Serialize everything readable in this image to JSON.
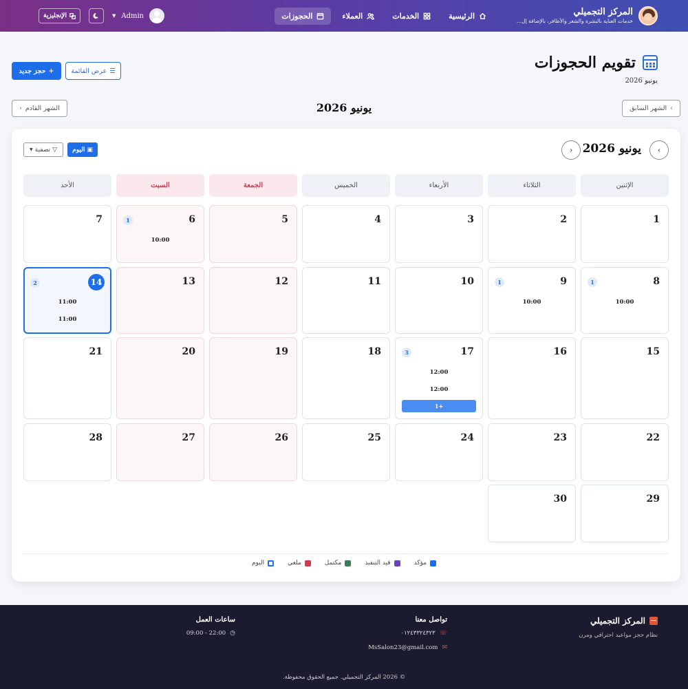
{
  "nav": {
    "brand_name": "المركز التجميلي",
    "brand_tagline": "خدمات العناية بالبشرة والشعر والأظافر، بالإضافة إل...",
    "links": [
      {
        "label": "الرئيسية",
        "icon": "home-icon"
      },
      {
        "label": "الخدمات",
        "icon": "grid-icon"
      },
      {
        "label": "العملاء",
        "icon": "users-icon"
      },
      {
        "label": "الحجوزات",
        "icon": "calendar-icon",
        "active": true
      }
    ],
    "admin_name": "Admin",
    "lang_label": "الإنجليزية"
  },
  "header": {
    "title": "تقويم الحجوزات",
    "subtitle": "يونيو 2026",
    "new_booking": "حجز جديد",
    "list_view": "عرض القائمة",
    "prev_month": "الشهر السابق",
    "next_month": "الشهر القادم",
    "month_label": "يونيو 2026"
  },
  "calendar": {
    "title": "يونيو 2026",
    "today_label": "اليوم",
    "filter_label": "تصفية",
    "weekdays": [
      "الإثنين",
      "الثلاثاء",
      "الأربعاء",
      "الخميس",
      "الجمعة",
      "السبت",
      "الأحد"
    ],
    "weeks": [
      [
        {
          "day": "1"
        },
        {
          "day": "2"
        },
        {
          "day": "3"
        },
        {
          "day": "4"
        },
        {
          "day": "5"
        },
        {
          "day": "6",
          "count": "1",
          "events": [
            "10:00"
          ]
        },
        {
          "day": "7"
        }
      ],
      [
        {
          "day": "8",
          "count": "1",
          "events": [
            "10:00"
          ]
        },
        {
          "day": "9",
          "count": "1",
          "events": [
            "10:00"
          ]
        },
        {
          "day": "10"
        },
        {
          "day": "11"
        },
        {
          "day": "12"
        },
        {
          "day": "13"
        },
        {
          "day": "14",
          "count": "2",
          "events": [
            "11:00",
            "11:00"
          ],
          "today": true
        }
      ],
      [
        {
          "day": "15"
        },
        {
          "day": "16"
        },
        {
          "day": "17",
          "count": "3",
          "events": [
            "12:00",
            "12:00"
          ],
          "more": "+1"
        },
        {
          "day": "18"
        },
        {
          "day": "19"
        },
        {
          "day": "20"
        },
        {
          "day": "21"
        }
      ],
      [
        {
          "day": "22"
        },
        {
          "day": "23"
        },
        {
          "day": "24"
        },
        {
          "day": "25"
        },
        {
          "day": "26"
        },
        {
          "day": "27"
        },
        {
          "day": "28"
        }
      ],
      [
        {
          "day": "29"
        },
        {
          "day": "30"
        }
      ]
    ]
  },
  "legend": [
    {
      "label": "مؤكد",
      "color": "#1d6ee8"
    },
    {
      "label": "قيد التنفيذ",
      "color": "#6f42c1"
    },
    {
      "label": "مكتمل",
      "color": "#3d7d53"
    },
    {
      "label": "ملغي",
      "color": "#d63a4a"
    },
    {
      "label": "اليوم",
      "color": "#1d6ee8"
    }
  ],
  "footer": {
    "brand": "المركز التجميلي",
    "tagline": "نظام حجز مواعيد احترافي ومرن",
    "contact_title": "تواصل معنا",
    "phone": "٠١٢٤٣٣٢٤٣٢٣",
    "email": "MsSalon23@gmail.com",
    "hours_title": "ساعات العمل",
    "hours": "22:00 - 09:00",
    "copyright": "© 2026 المركز التجميلي. جميع الحقوق محفوظة."
  }
}
